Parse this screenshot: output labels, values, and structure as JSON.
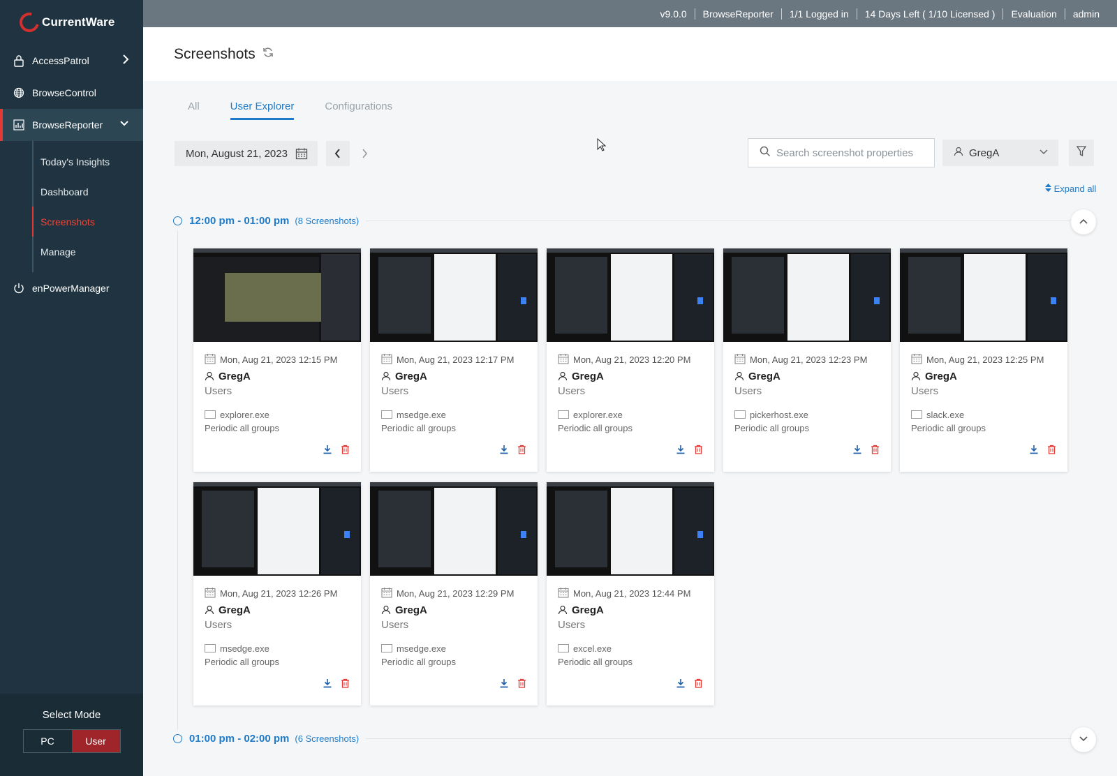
{
  "brand": {
    "name": "CurrentWare"
  },
  "topbar": {
    "items": [
      "v9.0.0",
      "BrowseReporter",
      "1/1 Logged in",
      "14 Days Left ( 1/10 Licensed )",
      "Evaluation",
      "admin"
    ]
  },
  "sidebar": {
    "items": [
      {
        "label": "AccessPatrol",
        "icon": "lock-icon"
      },
      {
        "label": "BrowseControl",
        "icon": "globe-icon"
      },
      {
        "label": "BrowseReporter",
        "icon": "chart-icon"
      },
      {
        "label": "enPowerManager",
        "icon": "power-icon"
      }
    ],
    "subitems": [
      "Today's Insights",
      "Dashboard",
      "Screenshots",
      "Manage"
    ],
    "active_sub": "Screenshots"
  },
  "mode": {
    "title": "Select Mode",
    "pc": "PC",
    "user": "User",
    "selected": "User"
  },
  "header": {
    "title": "Screenshots"
  },
  "tabs": [
    "All",
    "User Explorer",
    "Configurations"
  ],
  "active_tab": "User Explorer",
  "toolbar": {
    "date": "Mon, August 21, 2023",
    "search_placeholder": "Search screenshot properties",
    "user": "GregA",
    "expand_all": "Expand all"
  },
  "groups": [
    {
      "time": "12:00 pm - 01:00 pm",
      "count": "(8 Screenshots)",
      "cards": [
        {
          "datetime": "Mon, Aug 21, 2023 12:15 PM",
          "user": "GregA",
          "group": "Users",
          "process": "explorer.exe",
          "rule": "Periodic all groups"
        },
        {
          "datetime": "Mon, Aug 21, 2023 12:17 PM",
          "user": "GregA",
          "group": "Users",
          "process": "msedge.exe",
          "rule": "Periodic all groups"
        },
        {
          "datetime": "Mon, Aug 21, 2023 12:20 PM",
          "user": "GregA",
          "group": "Users",
          "process": "explorer.exe",
          "rule": "Periodic all groups"
        },
        {
          "datetime": "Mon, Aug 21, 2023 12:23 PM",
          "user": "GregA",
          "group": "Users",
          "process": "pickerhost.exe",
          "rule": "Periodic all groups"
        },
        {
          "datetime": "Mon, Aug 21, 2023 12:25 PM",
          "user": "GregA",
          "group": "Users",
          "process": "slack.exe",
          "rule": "Periodic all groups"
        },
        {
          "datetime": "Mon, Aug 21, 2023 12:26 PM",
          "user": "GregA",
          "group": "Users",
          "process": "msedge.exe",
          "rule": "Periodic all groups"
        },
        {
          "datetime": "Mon, Aug 21, 2023 12:29 PM",
          "user": "GregA",
          "group": "Users",
          "process": "msedge.exe",
          "rule": "Periodic all groups"
        },
        {
          "datetime": "Mon, Aug 21, 2023 12:44 PM",
          "user": "GregA",
          "group": "Users",
          "process": "excel.exe",
          "rule": "Periodic all groups"
        }
      ]
    },
    {
      "time": "01:00 pm - 02:00 pm",
      "count": "(6 Screenshots)"
    }
  ],
  "colors": {
    "accent": "#1f7bc9",
    "sidebar": "#1f3440",
    "danger": "#e53935"
  }
}
